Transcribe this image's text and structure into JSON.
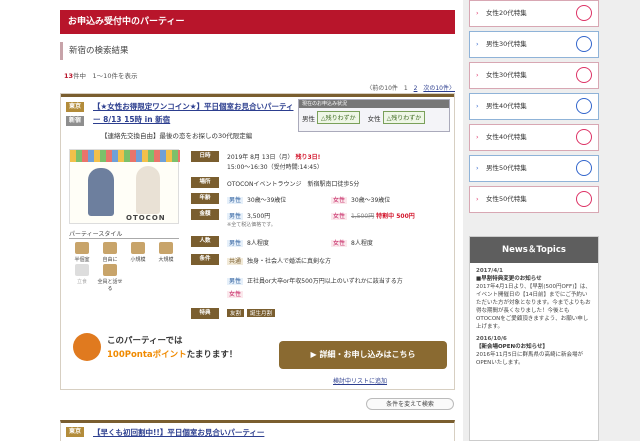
{
  "header_title": "お申込み受付中のパーティー",
  "subhead": "新宿の検索結果",
  "count": {
    "num": "13",
    "text": "件中　1〜10件を表示"
  },
  "pager": {
    "prev": "〈前の10件",
    "p1": "1",
    "p2": "2",
    "next": "次の10件〉"
  },
  "card": {
    "tag1": "東京",
    "tag2": "新宿",
    "title": "【★女性お得限定ワンコイン★】平日個室お見合いパーティー 8/13 15時 in 新宿",
    "subtitle": "【連絡先交換自由】最後の恋をお探しの30代限定編",
    "status_head": "現在のお申込み状況",
    "male_label": "男性",
    "male_status": "△残りわずか",
    "female_label": "女性",
    "female_status": "△残りわずか",
    "logo": "OTOCON",
    "date_key": "日時",
    "date_val": "2019年 8月 13日（月）",
    "date_flag": "残り3日!",
    "time_val": "15:00〜16:30（受付時間:14:45）",
    "place_key": "場所",
    "place_val": "OTOCONイベントラウンジ　新宿駅南口徒歩5分",
    "age_key": "年齢",
    "age_male": "30歳〜39歳位",
    "age_female": "30歳〜39歳位",
    "price_key": "金額",
    "price_male": "3,500円",
    "price_female_old": "1,500円",
    "price_female_new": "特割中 500円",
    "price_note": "※全て税込価格です。",
    "people_key": "人数",
    "people_male": "8人程度",
    "people_female": "8人程度",
    "cond_key": "条件",
    "cond_common_label": "共通",
    "cond_common": "独身・社会人で婚活に真剣な方",
    "cond_male": "正社員or大卒or年収500万円以上のいずれかに該当する方",
    "perk_key": "特典",
    "perk1": "友割",
    "perk2": "誕生月割",
    "style_head": "パーティースタイル",
    "styles": [
      "半個室",
      "自由に",
      "小規模",
      "大規模",
      "立食",
      "全員と話せる"
    ],
    "ponta1": "このパーティーでは",
    "ponta2_pre": "100Pontaポイント",
    "ponta2_post": "たまります！",
    "apply": "詳細・お申し込みはこちら",
    "listlink": "検討中リストに追加"
  },
  "cond_button": "条件を変えて検索",
  "card2": {
    "tag": "東京",
    "title": "【早くも初回割中!!】平日個室お見合いパーティー"
  },
  "sidebar": {
    "items": [
      {
        "label": "女性20代特集",
        "color": "pink"
      },
      {
        "label": "男性30代特集",
        "color": "blue"
      },
      {
        "label": "女性30代特集",
        "color": "pink"
      },
      {
        "label": "男性40代特集",
        "color": "blue"
      },
      {
        "label": "女性40代特集",
        "color": "pink"
      },
      {
        "label": "男性50代特集",
        "color": "blue"
      },
      {
        "label": "女性50代特集",
        "color": "pink"
      }
    ],
    "news_title": "News＆Topics",
    "news": [
      {
        "date": "2017/4/1",
        "head": "■早割特典変更のお知らせ",
        "body": "2017年4月1日より、【早割(500円OFF)】は、イベント開催日の【14日前】までにご予約いただいた方が対象となります。今までよりもお得な期間が長くなりました！今後ともOTOCONをご愛顧頂きますよう、お願い申し上げます。"
      },
      {
        "date": "2016/10/6",
        "head": "【新会場OPENのお知らせ】",
        "body": "2016年11月5日に群馬県の高崎に新会場がOPENいたします。"
      }
    ]
  }
}
